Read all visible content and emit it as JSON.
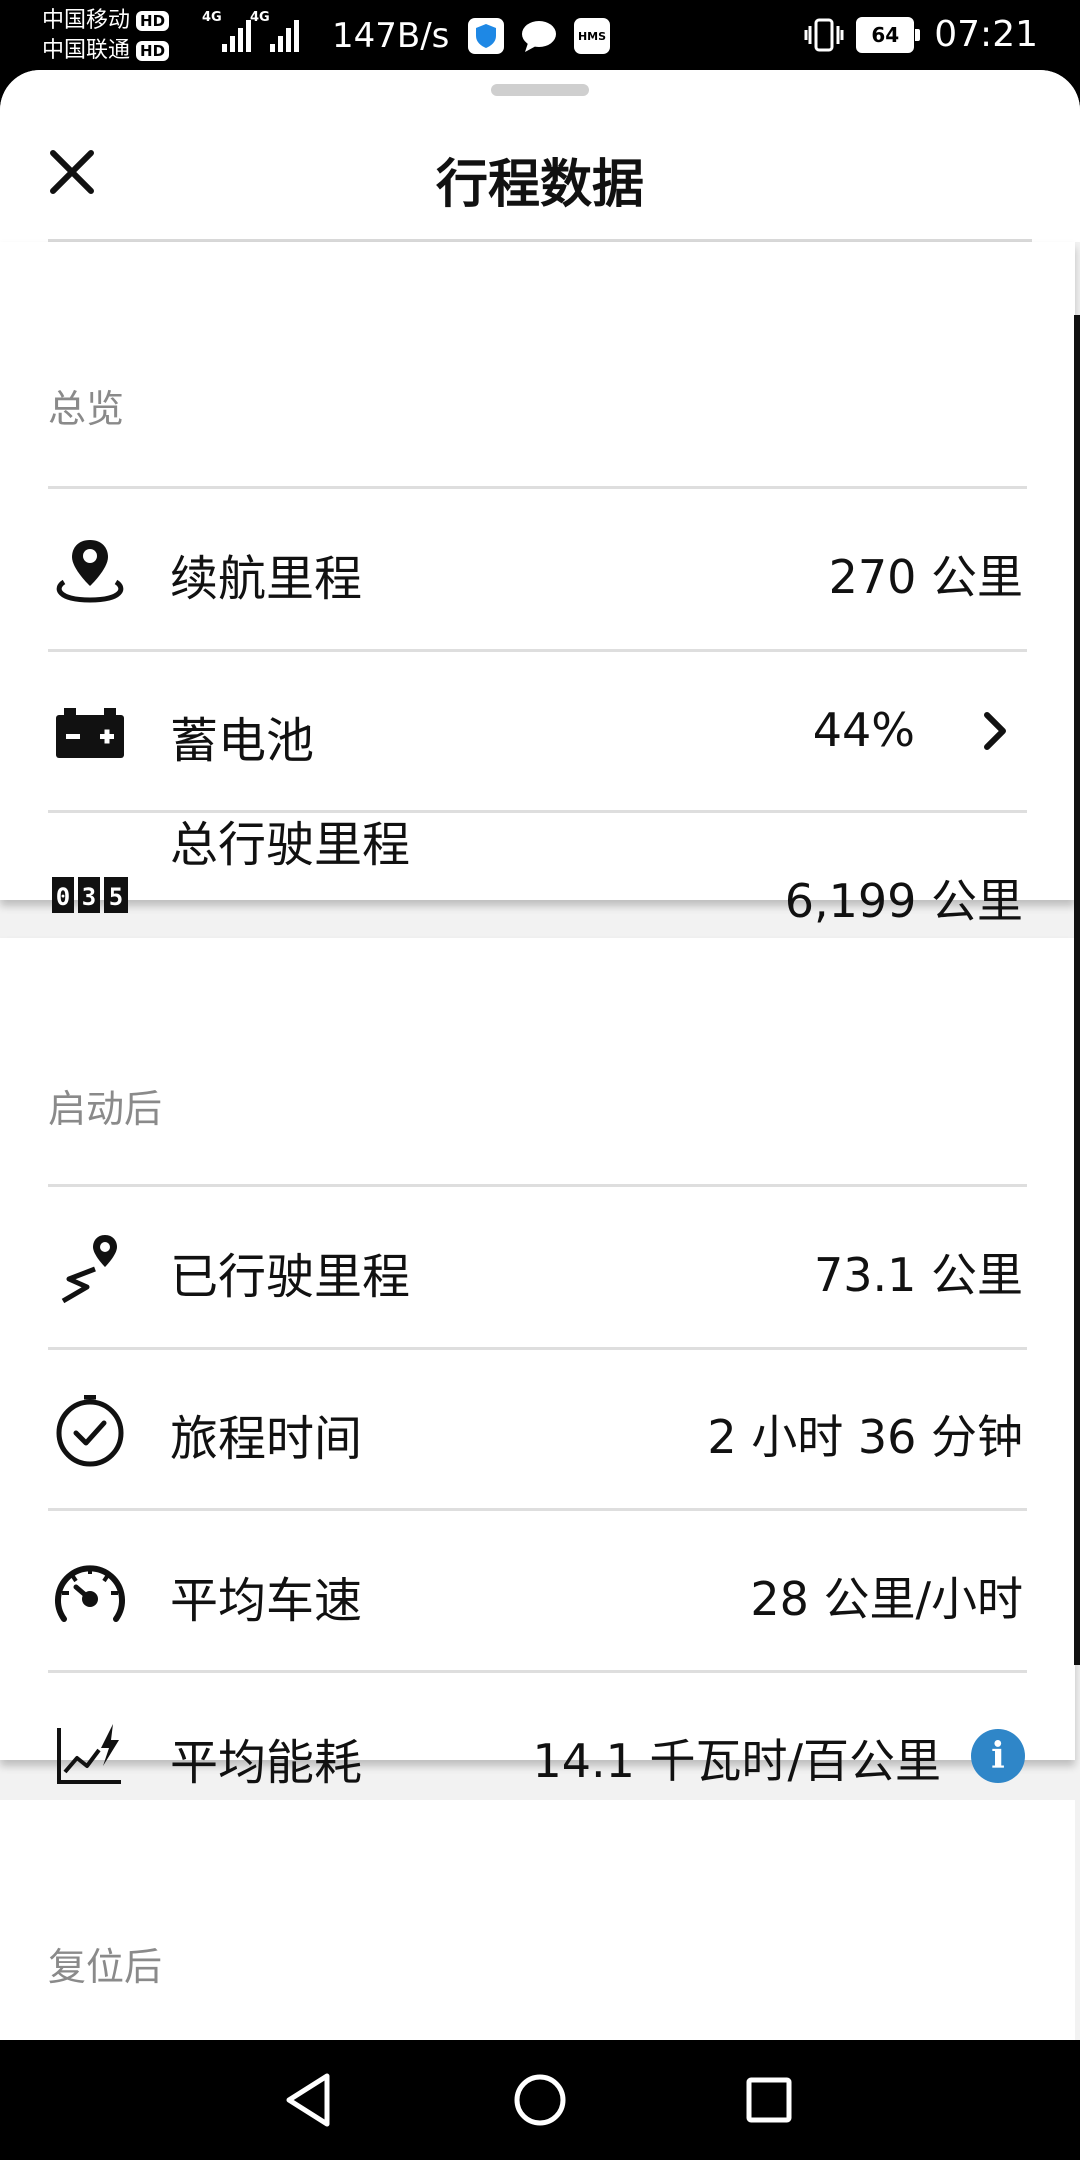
{
  "status_bar": {
    "carrier1": "中国移动",
    "carrier2": "中国联通",
    "hd_badge": "HD",
    "network1": "4G",
    "network2": "4G",
    "net_speed": "147B/s",
    "hms_label": "HMS",
    "battery": "64",
    "time": "07:21"
  },
  "header": {
    "title": "行程数据"
  },
  "sections": {
    "overview": {
      "title": "总览",
      "rows": [
        {
          "label": "续航里程",
          "value": "270 公里",
          "icon": "location-pin-icon"
        },
        {
          "label": "蓄电池",
          "value": "44%",
          "icon": "battery-icon"
        },
        {
          "label": "总行驶里程",
          "value": "6,199 公里",
          "icon": "odometer-icon",
          "odometer_digits": "035"
        }
      ]
    },
    "since_start": {
      "title": "启动后",
      "rows": [
        {
          "label": "已行驶里程",
          "value": "73.1 公里",
          "icon": "route-pin-icon"
        },
        {
          "label": "旅程时间",
          "value": "2 小时 36 分钟",
          "icon": "clock-icon"
        },
        {
          "label": "平均车速",
          "value": "28 公里/小时",
          "icon": "speedometer-icon"
        },
        {
          "label": "平均能耗",
          "value": "14.1 千瓦时/百公里",
          "icon": "energy-chart-icon",
          "info": "i"
        }
      ]
    },
    "since_reset": {
      "title": "复位后"
    }
  },
  "colors": {
    "accent_info": "#2f86c8",
    "section_title": "#8a8a8a",
    "background": "#f2f2f2"
  }
}
